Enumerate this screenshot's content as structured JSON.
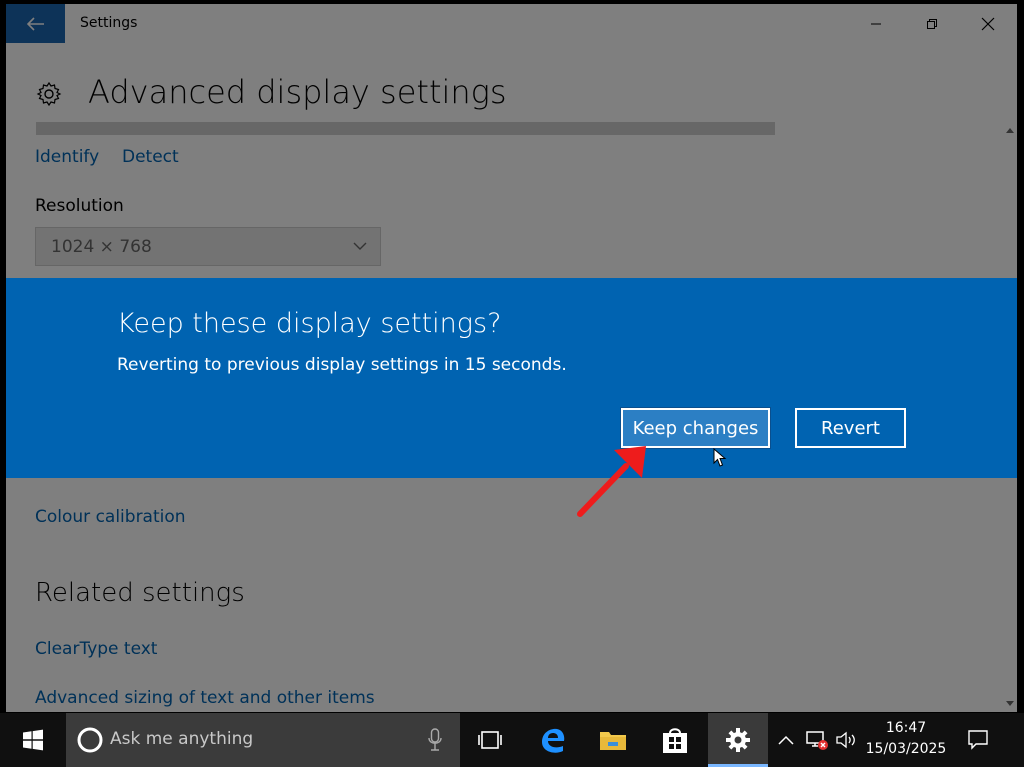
{
  "window": {
    "title": "Settings",
    "controls": {
      "minimize": "minimize-icon",
      "restore": "restore-icon",
      "close": "close-icon"
    }
  },
  "page": {
    "title": "Advanced display settings",
    "identify_link": "Identify",
    "detect_link": "Detect",
    "resolution_label": "Resolution",
    "resolution_value": "1024 × 768",
    "colour_calibration_link": "Colour calibration",
    "related_title": "Related settings",
    "cleartype_link": "ClearType text",
    "advanced_sizing_link": "Advanced sizing of text and other items"
  },
  "dialog": {
    "title": "Keep these display settings?",
    "message": "Reverting to previous display settings in 15 seconds.",
    "keep_label": "Keep changes",
    "revert_label": "Revert"
  },
  "taskbar": {
    "search_placeholder": "Ask me anything",
    "time": "16:47",
    "date": "15/03/2025",
    "apps": [
      "task-view-icon",
      "edge-icon",
      "file-explorer-icon",
      "store-icon",
      "settings-icon"
    ]
  },
  "colors": {
    "accent": "#0063b1",
    "titlebar_back": "#1a66b0",
    "annotation_arrow": "#ee1c1c"
  }
}
